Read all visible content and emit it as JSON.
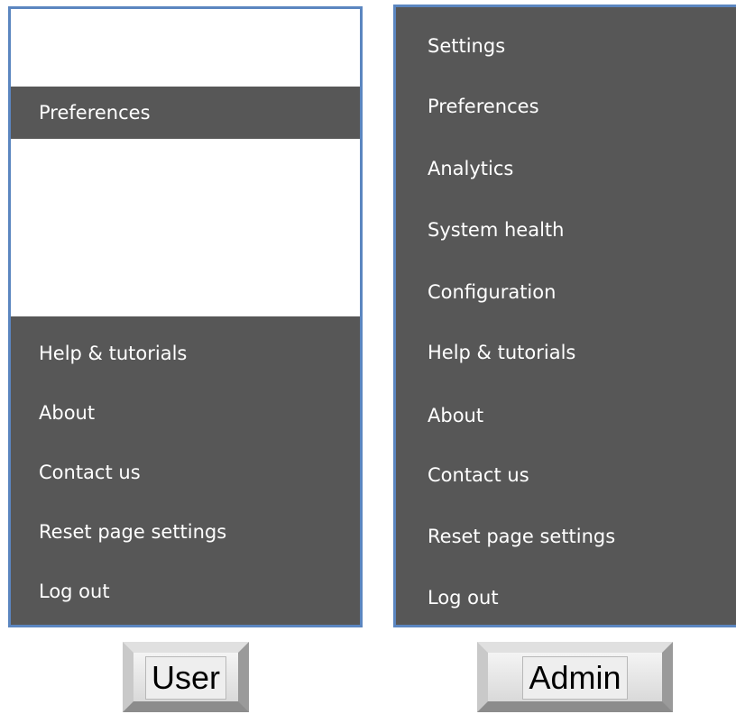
{
  "user_menu": {
    "items": [
      "Preferences",
      "Help & tutorials",
      "About",
      "Contact us",
      "Reset page settings",
      "Log out"
    ]
  },
  "admin_menu": {
    "items": [
      "Settings",
      "Preferences",
      "Analytics",
      "System health",
      "Configuration",
      "Help & tutorials",
      "About",
      "Contact us",
      "Reset page settings",
      "Log out"
    ]
  },
  "buttons": {
    "user_label": "User",
    "admin_label": "Admin"
  },
  "colors": {
    "menu_background": "#575757",
    "menu_text": "#ffffff",
    "panel_border": "#5b86c0",
    "panel_background": "#ffffff"
  }
}
